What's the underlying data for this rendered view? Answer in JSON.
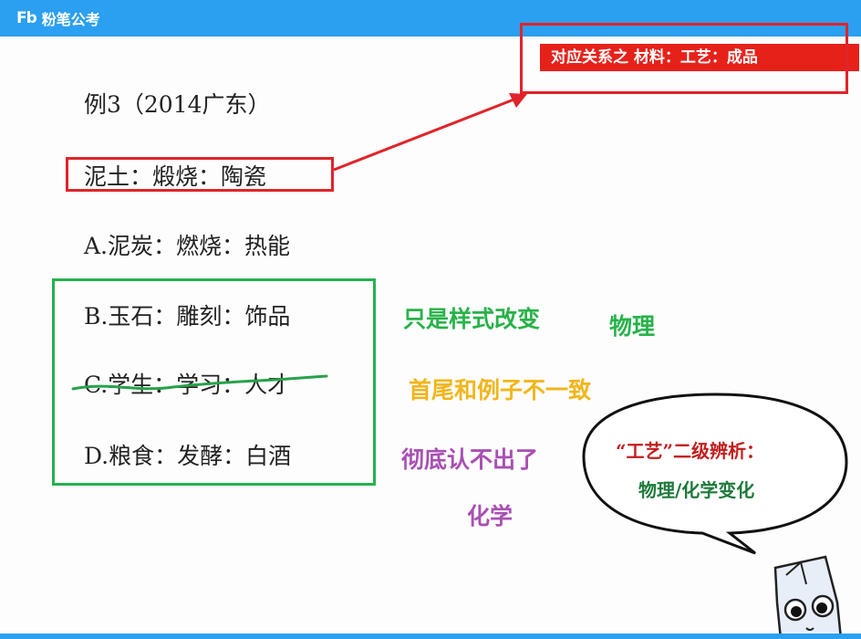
{
  "app": {
    "logo_mark": "Fb",
    "logo_text": "粉笔公考"
  },
  "banner": {
    "text": "对应关系之  材料：工艺：成品"
  },
  "question": {
    "title": "例3（2014广东）",
    "stem": "泥土：煅烧：陶瓷",
    "options": [
      {
        "label": "A.泥炭：燃烧：热能"
      },
      {
        "label": "B.玉石：雕刻：饰品"
      },
      {
        "label": "C.学生：学习：人才"
      },
      {
        "label": "D.粮食：发酵：白酒"
      }
    ]
  },
  "annotations": {
    "style_change": "只是样式改变",
    "physical": "物理",
    "inconsistent": "首尾和例子不一致",
    "unrecognizable": "彻底认不出了",
    "chemical": "化学"
  },
  "bubble": {
    "line1": "“工艺”二级辨析：",
    "line2": "物理/化学变化"
  },
  "colors": {
    "topbar": "#2b9ff0",
    "banner_red": "#e6211a",
    "box_red": "#e0242a",
    "box_green": "#25b24e",
    "note_green": "#27b349",
    "note_yellow": "#f2b51a",
    "note_purple": "#a94fb3"
  }
}
